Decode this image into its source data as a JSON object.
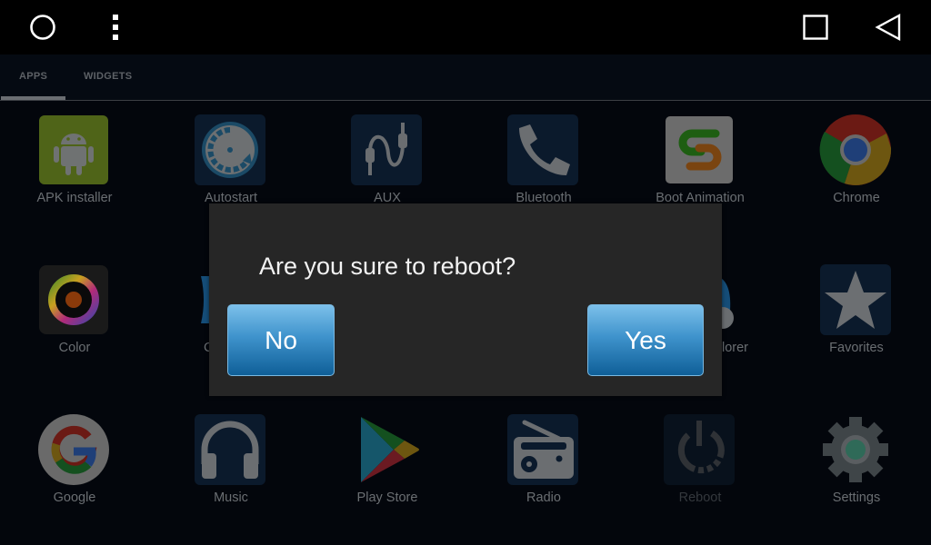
{
  "navbar": {
    "home_icon": "circle-home-icon",
    "menu_icon": "vertical-dots-icon",
    "recents_icon": "square-recents-icon",
    "back_icon": "triangle-back-icon"
  },
  "tabs": [
    {
      "label": "APPS",
      "selected": true
    },
    {
      "label": "WIDGETS",
      "selected": false
    }
  ],
  "apps": [
    {
      "label": "APK installer",
      "icon": "android-icon"
    },
    {
      "label": "Autostart",
      "icon": "autostart-gauge-icon"
    },
    {
      "label": "AUX",
      "icon": "aux-cable-icon"
    },
    {
      "label": "Bluetooth",
      "icon": "phone-icon"
    },
    {
      "label": "Boot Animation",
      "icon": "boot-animation-s-icon"
    },
    {
      "label": "Chrome",
      "icon": "chrome-icon"
    },
    {
      "label": "Color",
      "icon": "color-wheel-icon"
    },
    {
      "label": "C",
      "icon": "partially-hidden-blue-icon"
    },
    {
      "label": "lorer",
      "icon": "partially-hidden-explorer-icon"
    },
    {
      "label": "Favorites",
      "icon": "star-icon"
    },
    {
      "label": "Google",
      "icon": "google-g-icon"
    },
    {
      "label": "Music",
      "icon": "headphones-icon"
    },
    {
      "label": "Play Store",
      "icon": "play-store-icon"
    },
    {
      "label": "Radio",
      "icon": "radio-icon"
    },
    {
      "label": "Reboot",
      "icon": "power-icon"
    },
    {
      "label": "Settings",
      "icon": "gear-icon"
    }
  ],
  "dialog": {
    "message": "Are you sure to reboot?",
    "no_label": "No",
    "yes_label": "Yes"
  },
  "colors": {
    "button_top": "#7cc0ea",
    "button_bottom": "#0f5f98",
    "dialog_bg": "#262626"
  }
}
